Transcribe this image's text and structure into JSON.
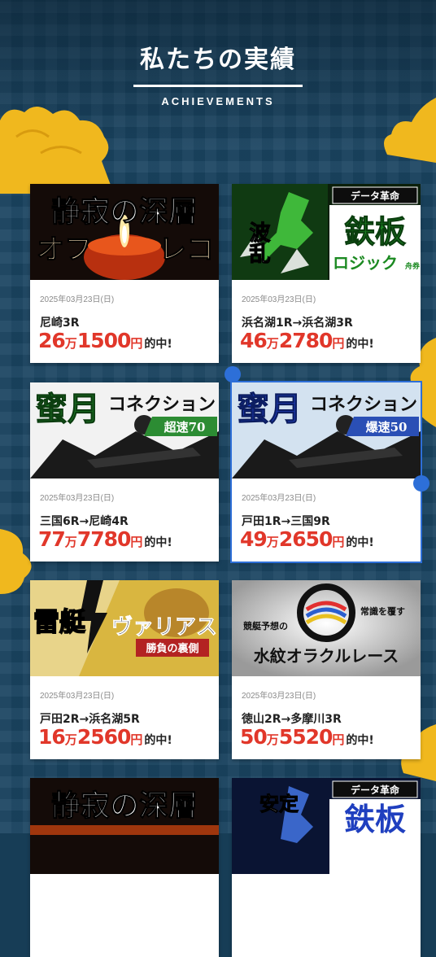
{
  "section": {
    "title": "私たちの実績",
    "subtitle": "ACHIEVEMENTS"
  },
  "cards": [
    {
      "banner": {
        "line1": "静寂の深層",
        "line2": "オフ",
        "line3": "レコ"
      },
      "date": "2025年03月23日(日)",
      "race": "尼崎3R",
      "amount_a": "26",
      "unit_a": "万",
      "amount_b": "1500",
      "unit_b": "円",
      "suffix": "的中!"
    },
    {
      "banner": {
        "left": "波乱",
        "tag": "データ革命",
        "main": "鉄板",
        "sub": "ロジック",
        "small": "舟券"
      },
      "date": "2025年03月23日(日)",
      "race": "浜名湖1R→浜名湖3R",
      "amount_a": "46",
      "unit_a": "万",
      "amount_b": "2780",
      "unit_b": "円",
      "suffix": "的中!"
    },
    {
      "banner": {
        "main": "蜜月",
        "kana": "コネクション",
        "badge": "超速70"
      },
      "date": "2025年03月23日(日)",
      "race": "三国6R→尼崎4R",
      "amount_a": "77",
      "unit_a": "万",
      "amount_b": "7780",
      "unit_b": "円",
      "suffix": "的中!"
    },
    {
      "banner": {
        "main": "蜜月",
        "kana": "コネクション",
        "badge": "爆速50"
      },
      "date": "2025年03月23日(日)",
      "race": "戸田1R→三国9R",
      "amount_a": "49",
      "unit_a": "万",
      "amount_b": "2650",
      "unit_b": "円",
      "suffix": "的中!"
    },
    {
      "banner": {
        "left": "雷艇",
        "right": "ヴァリアス",
        "sub": "勝負の裏側"
      },
      "date": "2025年03月23日(日)",
      "race": "戸田2R→浜名湖5R",
      "amount_a": "16",
      "unit_a": "万",
      "amount_b": "2560",
      "unit_b": "円",
      "suffix": "的中!"
    },
    {
      "banner": {
        "top_left": "競艇予想の",
        "top_right": "常識を覆す",
        "main": "水紋オラクルレース"
      },
      "date": "2025年03月23日(日)",
      "race": "徳山2R→多摩川3R",
      "amount_a": "50",
      "unit_a": "万",
      "amount_b": "5520",
      "unit_b": "円",
      "suffix": "的中!"
    },
    {
      "banner": {
        "line1": "静寂の深層"
      }
    },
    {
      "banner": {
        "left": "安定",
        "tag": "データ革命",
        "main": "鉄板"
      }
    }
  ],
  "colors": {
    "accent_red": "#e1372a",
    "background": "#1a4461",
    "cloud": "#f0b81e",
    "dot": "#2d6fd8"
  }
}
